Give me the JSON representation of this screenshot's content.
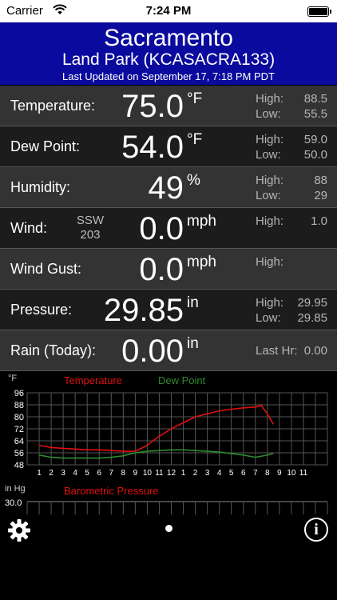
{
  "status_bar": {
    "carrier": "Carrier",
    "time": "7:24 PM"
  },
  "header": {
    "city": "Sacramento",
    "station": "Land Park (KCASACRA133)",
    "updated": "Last Updated on September 17, 7:18 PM PDT"
  },
  "rows": {
    "temperature": {
      "label": "Temperature:",
      "value": "75.0",
      "unit": "°F",
      "high_label": "High:",
      "high": "88.5",
      "low_label": "Low:",
      "low": "55.5"
    },
    "dew_point": {
      "label": "Dew Point:",
      "value": "54.0",
      "unit": "°F",
      "high_label": "High:",
      "high": "59.0",
      "low_label": "Low:",
      "low": "50.0"
    },
    "humidity": {
      "label": "Humidity:",
      "value": "49",
      "unit": "%",
      "high_label": "High:",
      "high": "88",
      "low_label": "Low:",
      "low": "29"
    },
    "wind": {
      "label": "Wind:",
      "dir": "SSW",
      "deg": "203",
      "value": "0.0",
      "unit": "mph",
      "high_label": "High:",
      "high": "1.0"
    },
    "wind_gust": {
      "label": "Wind Gust:",
      "value": "0.0",
      "unit": "mph",
      "high_label": "High:"
    },
    "pressure": {
      "label": "Pressure:",
      "value": "29.85",
      "unit": "in",
      "high_label": "High:",
      "high": "29.95",
      "low_label": "Low:",
      "low": "29.85"
    },
    "rain": {
      "label": "Rain (Today):",
      "value": "0.00",
      "unit": "in",
      "last_hr_label": "Last Hr:",
      "last_hr": "0.00"
    }
  },
  "chart_data": [
    {
      "type": "line",
      "yunit": "°F",
      "ylim": [
        48,
        96
      ],
      "y_ticks": [
        "96",
        "88",
        "80",
        "72",
        "64",
        "56",
        "48"
      ],
      "x_ticks": [
        "1",
        "2",
        "3",
        "4",
        "5",
        "6",
        "7",
        "8",
        "9",
        "10",
        "11",
        "12",
        "1",
        "2",
        "3",
        "4",
        "5",
        "6",
        "7",
        "8",
        "9",
        "10",
        "11"
      ],
      "grid": true,
      "legend": "top",
      "series": [
        {
          "name": "Temperature",
          "color": "#e01010",
          "x": [
            0,
            1,
            2,
            3,
            4,
            5,
            6,
            7,
            8,
            9,
            10,
            11,
            12,
            13,
            14,
            15,
            16,
            17,
            18,
            18.5,
            19,
            19.5
          ],
          "values": [
            61,
            59.5,
            59,
            58.5,
            58,
            58,
            57.5,
            57,
            57,
            61,
            67,
            72,
            76,
            80,
            82,
            84,
            85,
            86,
            86.5,
            87.5,
            82,
            75
          ]
        },
        {
          "name": "Dew Point",
          "color": "#2e8b2e",
          "x": [
            0,
            1,
            2,
            3,
            4,
            5,
            6,
            7,
            8,
            9,
            10,
            11,
            12,
            13,
            14,
            15,
            16,
            17,
            18,
            19,
            19.5
          ],
          "values": [
            54.5,
            53,
            52.5,
            52.5,
            52.5,
            52.5,
            53,
            54,
            56,
            57,
            57.5,
            58,
            58,
            57.5,
            57,
            56.5,
            55.5,
            54.5,
            53,
            54.5,
            55.5
          ]
        }
      ]
    },
    {
      "type": "line",
      "yunit": "in Hg",
      "y_ticks": [
        "30.0"
      ],
      "series": [
        {
          "name": "Barometric Pressure",
          "color": "#e01010"
        }
      ]
    }
  ],
  "toolbar": {
    "info_glyph": "i"
  },
  "colors": {
    "header_bg": "#0a0a9e",
    "row_odd": "#333333",
    "row_even": "#1c1c1c",
    "temp_line": "#e01010",
    "dew_line": "#2e8b2e"
  },
  "icons": {
    "settings": "gear-icon",
    "info": "info-icon",
    "wifi": "wifi-icon",
    "battery": "battery-icon"
  }
}
